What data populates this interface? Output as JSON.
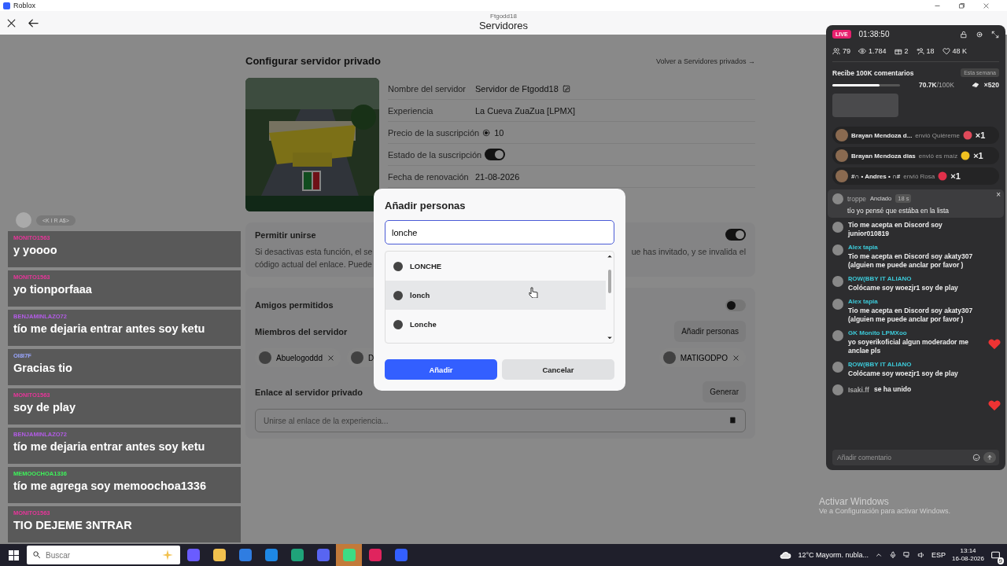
{
  "window": {
    "title": "Roblox"
  },
  "header": {
    "subtitle": "Ftgodd18",
    "title": "Servidores"
  },
  "page": {
    "title": "Configurar servidor privado",
    "back_link": "Volver a Servidores privados →",
    "details": [
      {
        "kind": "editable",
        "label": "Nombre del servidor",
        "value": "Servidor de Ftgodd18"
      },
      {
        "kind": "text",
        "label": "Experiencia",
        "value": "La Cueva ZuaZua [LPMX]"
      },
      {
        "kind": "price",
        "label": "Precio de la suscripción",
        "value": "10"
      },
      {
        "kind": "toggle",
        "label": "Estado de la suscripción",
        "on": true
      },
      {
        "kind": "text",
        "label": "Fecha de renovación",
        "value": "21-08-2026"
      }
    ],
    "allow_join": {
      "label": "Permitir unirse",
      "on": true,
      "description_left": [
        "Si desactivas esta función, el se",
        "código actual del enlace. Puede"
      ],
      "description_right": "ue has invitado, y se invalida el"
    },
    "friends": {
      "label": "Amigos permitidos",
      "on": false
    },
    "members": {
      "label": "Miembros del servidor",
      "button": "Añadir personas",
      "chips_left": [
        {
          "name": "Abuelogoddd",
          "removable": true
        },
        {
          "name": "D",
          "removable": false
        }
      ],
      "chips_right": [
        {
          "name": "MATIGODPO",
          "removable": true
        }
      ]
    },
    "link": {
      "label": "Enlace al servidor privado",
      "button": "Generar",
      "placeholder": "Unirse al enlace de la experiencia..."
    }
  },
  "dialog": {
    "title": "Añadir personas",
    "search": {
      "value": "lonche"
    },
    "results": [
      {
        "name": "LONCHE",
        "selected": false
      },
      {
        "name": "lonch",
        "selected": true
      },
      {
        "name": "Lonche",
        "selected": false
      }
    ],
    "buttons": [
      {
        "label": "Añadir",
        "kind": "primary"
      },
      {
        "label": "Cancelar",
        "kind": "secondary"
      }
    ]
  },
  "overlay_chat": {
    "top_user": "<K I R A$>",
    "messages": [
      {
        "user": "MONITO1563",
        "color": "#e8359a",
        "text": "y yoooo"
      },
      {
        "user": "MONITO1563",
        "color": "#e8359a",
        "text": "yo tionporfaaa"
      },
      {
        "user": "BENJAMINLAZO72",
        "color": "#b35ce6",
        "text": "tío me dejaria entrar antes soy ketu"
      },
      {
        "user": "OI8I7F",
        "color": "#9aa6ff",
        "text": "Gracias tio"
      },
      {
        "user": "MONITO1563",
        "color": "#e8359a",
        "text": "soy de play"
      },
      {
        "user": "BENJAMINLAZO72",
        "color": "#b35ce6",
        "text": "tío me dejaria entrar antes soy ketu"
      },
      {
        "user": "MEMOOCHOA1336",
        "color": "#3ef05a",
        "text": "tío me agrega soy memoochoa1336"
      },
      {
        "user": "MONITO1563",
        "color": "#e8359a",
        "text": "TIO DEJEME 3NTRAR"
      }
    ]
  },
  "live_panel": {
    "badge": "LIVE",
    "timer": "01:38:50",
    "stats": [
      {
        "kind": "viewers",
        "value": "79"
      },
      {
        "kind": "views",
        "value": "1.784"
      },
      {
        "kind": "gifts",
        "value": "2"
      },
      {
        "kind": "followers",
        "value": "18"
      },
      {
        "kind": "likes",
        "value": "48 K"
      }
    ],
    "goal": {
      "title": "Recibe 100K comentarios",
      "period": "Esta semana",
      "level": 0.7,
      "current": "70.7K",
      "target": "/100K",
      "reward": "×520"
    },
    "gifts": [
      {
        "user": "Brayan Mendoza d...",
        "action": "envió Quiéreme",
        "count": "×1",
        "color": "#e04a5a"
      },
      {
        "user": "Brayan Mendoza dias",
        "action": "envió es maíz",
        "count": "×1",
        "color": "#f0c020"
      },
      {
        "user": "#∩ • Andres • ∩#",
        "action": "envió Rosa",
        "count": "×1",
        "color": "#e0304a"
      }
    ],
    "pinned": {
      "user": "troppe",
      "tag": "Anclado",
      "age": "18 s",
      "text": "tío yo pensé que estába en la lista",
      "close": "×"
    },
    "comments": [
      {
        "kind": "message",
        "text": "Tio me acepta en Discord soy junior010819"
      },
      {
        "kind": "message",
        "user": "Alex tapia",
        "text": "Tio me acepta en Discord soy akaty307 (alguien me puede anclar por favor )"
      },
      {
        "kind": "message",
        "user": "ƦOW(BBY IT ALIANO",
        "text": "Colócame soy woezjr1 soy de play"
      },
      {
        "kind": "message",
        "user": "Alex tapia",
        "text": "Tio me acepta en Discord soy akaty307 (alguien me puede anclar por favor )"
      },
      {
        "kind": "message",
        "user": "GK Monito LPMXoo",
        "text": "yo soyerikoficial algun moderador me anclae pls"
      },
      {
        "kind": "message",
        "user": "ƦOW(BBY IT ALIANO",
        "text": "Colócame soy woezjr1 soy de play"
      },
      {
        "kind": "join",
        "user": "Isaki.ff",
        "text": "se ha unido"
      }
    ],
    "input": {
      "placeholder": "Añadir comentario"
    }
  },
  "activation_notice": {
    "title": "Activar Windows",
    "text": "Ve a Configuración para activar Windows."
  },
  "taskbar": {
    "search": {
      "placeholder": "Buscar"
    },
    "apps": [
      {
        "color": "#6a5cff"
      },
      {
        "color": "#f2c14e"
      },
      {
        "color": "#2f7de1"
      },
      {
        "color": "#1e88e5"
      },
      {
        "color": "#1fa37a"
      },
      {
        "color": "#5865f2"
      },
      {
        "color": "#3ddc84",
        "selected": true
      },
      {
        "color": "#e0245e",
        "selected": false
      },
      {
        "color": "#335fff",
        "selected": false
      }
    ],
    "weather": "12°C  Mayorm. nubla...",
    "language": "ESP",
    "time": "13:14",
    "date": "16-08-2026",
    "notifications": "9"
  }
}
